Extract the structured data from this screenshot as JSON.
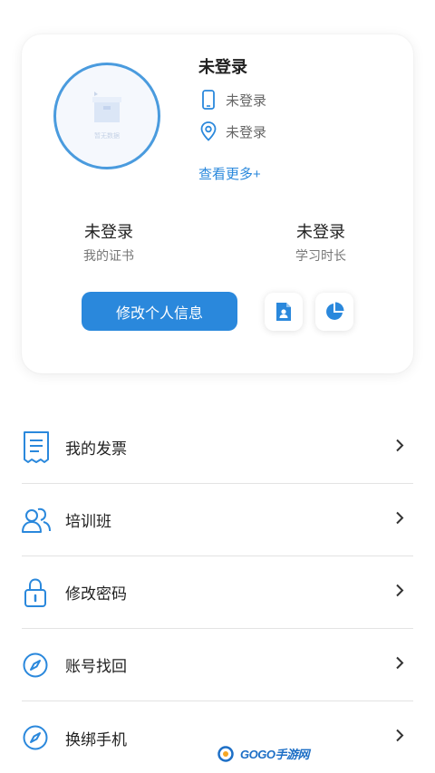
{
  "profile": {
    "avatar_caption": "暂无数据",
    "name": "未登录",
    "phone": "未登录",
    "location": "未登录",
    "more_link": "查看更多+"
  },
  "stats": [
    {
      "value": "未登录",
      "label": "我的证书"
    },
    {
      "value": "未登录",
      "label": "学习时长"
    }
  ],
  "edit_button": "修改个人信息",
  "colors": {
    "accent": "#2a88dc"
  },
  "menu": [
    {
      "label": "我的发票",
      "icon": "invoice-icon"
    },
    {
      "label": "培训班",
      "icon": "group-icon"
    },
    {
      "label": "修改密码",
      "icon": "lock-icon"
    },
    {
      "label": "账号找回",
      "icon": "compass-icon"
    },
    {
      "label": "换绑手机",
      "icon": "compass-icon"
    }
  ],
  "watermark": {
    "text": "GOGO手游网"
  }
}
